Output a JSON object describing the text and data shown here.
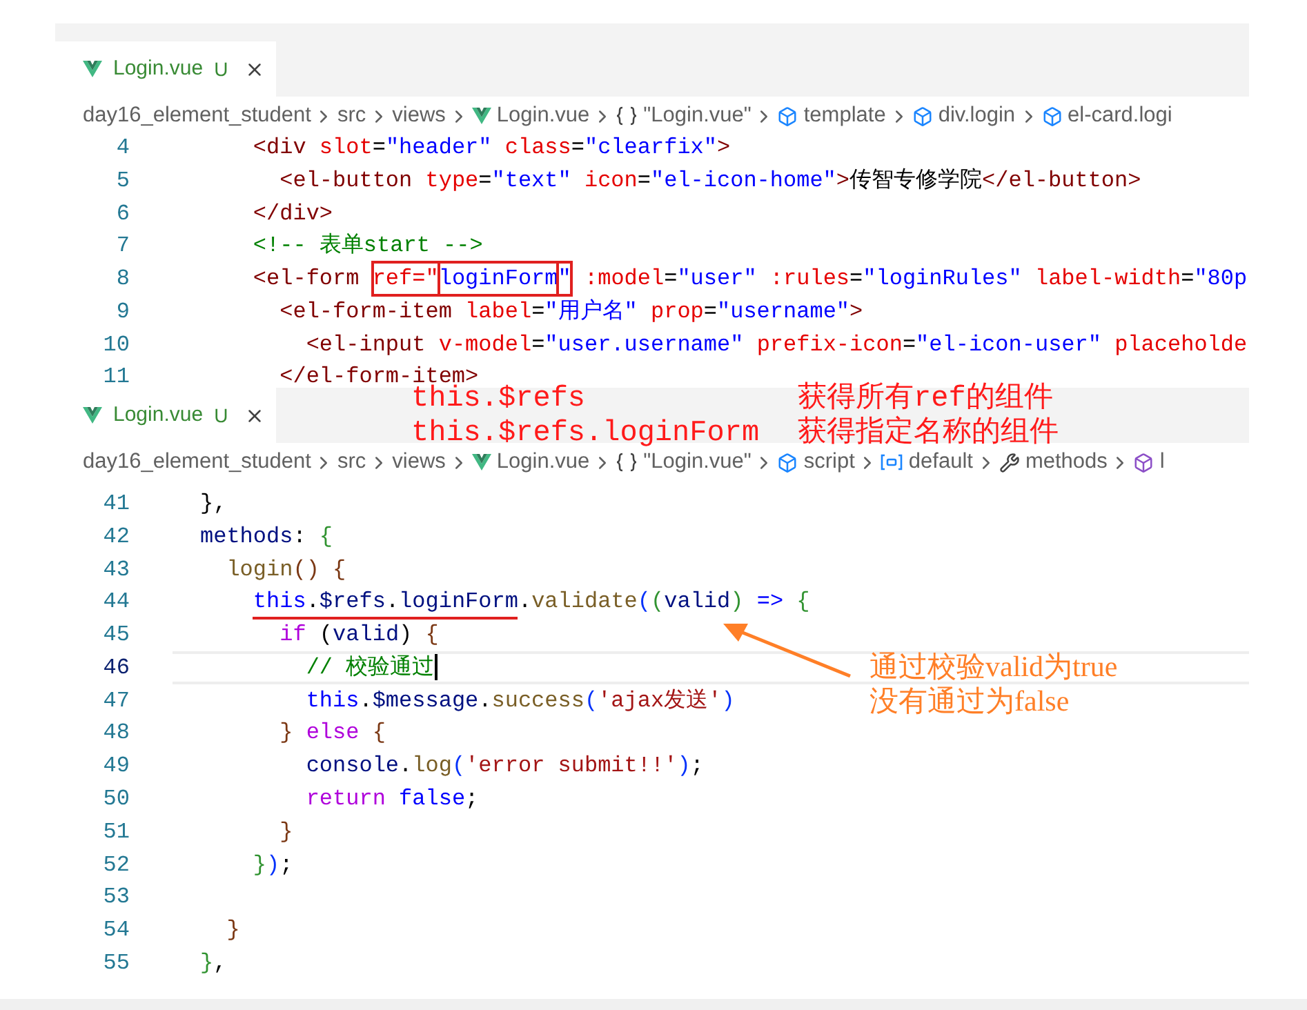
{
  "editors": [
    {
      "tab": {
        "label": "Login.vue",
        "badge": "U",
        "selected": true
      },
      "breadcrumb": [
        {
          "text": "day16_element_student",
          "kind": "folder"
        },
        {
          "text": "src",
          "kind": "folder"
        },
        {
          "text": "views",
          "kind": "folder"
        },
        {
          "text": "Login.vue",
          "kind": "vue"
        },
        {
          "text": "\"Login.vue\"",
          "kind": "braces"
        },
        {
          "text": "template",
          "kind": "cube"
        },
        {
          "text": "div.login",
          "kind": "cube"
        },
        {
          "text": "el-card.logi",
          "kind": "cube"
        }
      ],
      "lines": [
        {
          "number": "4",
          "current": false,
          "tokens": [
            {
              "text": "    <div",
              "kind": "tag"
            },
            {
              "text": " slot",
              "kind": "attr"
            },
            {
              "text": "="
            },
            {
              "text": "\"header\"",
              "kind": "val"
            },
            {
              "text": " class",
              "kind": "attr"
            },
            {
              "text": "="
            },
            {
              "text": "\"clearfix\"",
              "kind": "val"
            },
            {
              "text": ">",
              "kind": "tag"
            }
          ]
        },
        {
          "number": "5",
          "current": false,
          "tokens": [
            {
              "text": "      <el-button",
              "kind": "tag"
            },
            {
              "text": " type",
              "kind": "attr"
            },
            {
              "text": "="
            },
            {
              "text": "\"text\"",
              "kind": "val"
            },
            {
              "text": " icon",
              "kind": "attr"
            },
            {
              "text": "="
            },
            {
              "text": "\"el-icon-home\"",
              "kind": "val"
            },
            {
              "text": ">",
              "kind": "tag"
            },
            {
              "text": "传智专修学院"
            },
            {
              "text": "</el-button>",
              "kind": "tag"
            }
          ]
        },
        {
          "number": "6",
          "current": false,
          "tokens": [
            {
              "text": "    </div>",
              "kind": "tag"
            }
          ]
        },
        {
          "number": "7",
          "current": false,
          "tokens": [
            {
              "text": "    <!-- 表单start -->",
              "kind": "comment"
            }
          ]
        },
        {
          "number": "8",
          "current": false,
          "tokens": [
            {
              "text": "    <el-form ",
              "kind": "tag"
            },
            {
              "text": "ref=\"",
              "kind": "attr",
              "boxed": true
            },
            {
              "text": "loginForm",
              "kind": "val",
              "boxed": true
            },
            {
              "text": "\"",
              "kind": "val",
              "boxed": true
            },
            {
              "text": " :model",
              "kind": "attr"
            },
            {
              "text": "="
            },
            {
              "text": "\"user\"",
              "kind": "val"
            },
            {
              "text": " :rules",
              "kind": "attr"
            },
            {
              "text": "="
            },
            {
              "text": "\"loginRules\"",
              "kind": "val"
            },
            {
              "text": " label-width",
              "kind": "attr"
            },
            {
              "text": "="
            },
            {
              "text": "\"80p",
              "kind": "val"
            }
          ]
        },
        {
          "number": "9",
          "current": false,
          "tokens": [
            {
              "text": "      <el-form-item",
              "kind": "tag"
            },
            {
              "text": " label",
              "kind": "attr"
            },
            {
              "text": "="
            },
            {
              "text": "\"用户名\"",
              "kind": "val"
            },
            {
              "text": " prop",
              "kind": "attr"
            },
            {
              "text": "="
            },
            {
              "text": "\"username\"",
              "kind": "val"
            },
            {
              "text": ">",
              "kind": "tag"
            }
          ]
        },
        {
          "number": "10",
          "current": false,
          "tokens": [
            {
              "text": "        <el-input",
              "kind": "tag"
            },
            {
              "text": " v-model",
              "kind": "attr"
            },
            {
              "text": "="
            },
            {
              "text": "\"user.username\"",
              "kind": "val"
            },
            {
              "text": " prefix-icon",
              "kind": "attr"
            },
            {
              "text": "="
            },
            {
              "text": "\"el-icon-user\"",
              "kind": "val"
            },
            {
              "text": " placeholde",
              "kind": "attr"
            }
          ]
        },
        {
          "number": "11",
          "current": false,
          "tokens": [
            {
              "text": "      </el-form-item>",
              "kind": "tag"
            }
          ]
        }
      ]
    },
    {
      "tab": {
        "label": "Login.vue",
        "badge": "U",
        "selected": true
      },
      "breadcrumb": [
        {
          "text": "day16_element_student",
          "kind": "folder"
        },
        {
          "text": "src",
          "kind": "folder"
        },
        {
          "text": "views",
          "kind": "folder"
        },
        {
          "text": "Login.vue",
          "kind": "vue"
        },
        {
          "text": "\"Login.vue\"",
          "kind": "braces"
        },
        {
          "text": "script",
          "kind": "cube"
        },
        {
          "text": "default",
          "kind": "variable"
        },
        {
          "text": "methods",
          "kind": "wrench"
        },
        {
          "text": "l",
          "kind": "method"
        }
      ],
      "lines": [
        {
          "number": "41",
          "current": false,
          "tokens": [
            {
              "text": "},"
            }
          ]
        },
        {
          "number": "42",
          "current": false,
          "tokens": [
            {
              "text": "methods",
              "kind": "var"
            },
            {
              "text": ": "
            },
            {
              "text": "{",
              "kind": "bracket2"
            }
          ]
        },
        {
          "number": "43",
          "current": false,
          "tokens": [
            {
              "text": "  login",
              "kind": "fn"
            },
            {
              "text": "() {",
              "kind": "bracket3"
            }
          ]
        },
        {
          "number": "44",
          "current": false,
          "tokens": [
            {
              "text": "    this",
              "kind": "kw",
              "underlined": true
            },
            {
              "text": ".",
              "underlined": true
            },
            {
              "text": "$refs",
              "kind": "var",
              "underlined": true
            },
            {
              "text": ".",
              "underlined": true
            },
            {
              "text": "loginForm",
              "kind": "var",
              "underlined": true
            },
            {
              "text": "."
            },
            {
              "text": "validate",
              "kind": "fn"
            },
            {
              "text": "(",
              "kind": "bracket1"
            },
            {
              "text": "(",
              "kind": "bracket2"
            },
            {
              "text": "valid",
              "kind": "var"
            },
            {
              "text": ")",
              "kind": "bracket2"
            },
            {
              "text": " => ",
              "kind": "kw"
            },
            {
              "text": "{",
              "kind": "bracket2"
            }
          ]
        },
        {
          "number": "45",
          "current": false,
          "tokens": [
            {
              "text": "      if",
              "kind": "ctrl"
            },
            {
              "text": " ("
            },
            {
              "text": "valid",
              "kind": "var"
            },
            {
              "text": ") "
            },
            {
              "text": "{",
              "kind": "bracket3"
            }
          ]
        },
        {
          "number": "46",
          "current": true,
          "tokens": [
            {
              "text": "        // 校验通过",
              "kind": "comment"
            }
          ]
        },
        {
          "number": "47",
          "current": false,
          "tokens": [
            {
              "text": "        this",
              "kind": "kw"
            },
            {
              "text": "."
            },
            {
              "text": "$message",
              "kind": "var"
            },
            {
              "text": "."
            },
            {
              "text": "success",
              "kind": "fn"
            },
            {
              "text": "(",
              "kind": "bracket1"
            },
            {
              "text": "'ajax发送'",
              "kind": "str"
            },
            {
              "text": ")",
              "kind": "bracket1"
            }
          ]
        },
        {
          "number": "48",
          "current": false,
          "tokens": [
            {
              "text": "      }",
              "kind": "bracket3"
            },
            {
              "text": " else",
              "kind": "ctrl"
            },
            {
              "text": " {",
              "kind": "bracket3"
            }
          ]
        },
        {
          "number": "49",
          "current": false,
          "tokens": [
            {
              "text": "        console",
              "kind": "var"
            },
            {
              "text": "."
            },
            {
              "text": "log",
              "kind": "fn"
            },
            {
              "text": "(",
              "kind": "bracket1"
            },
            {
              "text": "'error submit!!'",
              "kind": "str"
            },
            {
              "text": ")",
              "kind": "bracket1"
            },
            {
              "text": ";"
            }
          ]
        },
        {
          "number": "50",
          "current": false,
          "tokens": [
            {
              "text": "        return",
              "kind": "ctrl"
            },
            {
              "text": " false",
              "kind": "kw"
            },
            {
              "text": ";"
            }
          ]
        },
        {
          "number": "51",
          "current": false,
          "tokens": [
            {
              "text": "      }",
              "kind": "bracket3"
            }
          ]
        },
        {
          "number": "52",
          "current": false,
          "tokens": [
            {
              "text": "    }",
              "kind": "bracket2"
            },
            {
              "text": ")",
              "kind": "bracket1"
            },
            {
              "text": ";"
            }
          ]
        },
        {
          "number": "53",
          "current": false
        },
        {
          "number": "54",
          "current": false,
          "tokens": [
            {
              "text": "  }",
              "kind": "bracket3"
            }
          ]
        },
        {
          "number": "55",
          "current": false,
          "tokens": [
            {
              "text": "}",
              "kind": "bracket2"
            },
            {
              "text": ","
            }
          ]
        }
      ]
    }
  ],
  "annotations": {
    "refs_notes": [
      {
        "code": "this.$refs",
        "meaning": "获得所有ref的组件"
      },
      {
        "code": "this.$refs.loginForm",
        "meaning": "获得指定名称的组件"
      }
    ],
    "valid_note": [
      "通过校验valid为true",
      "没有通过为false"
    ]
  }
}
